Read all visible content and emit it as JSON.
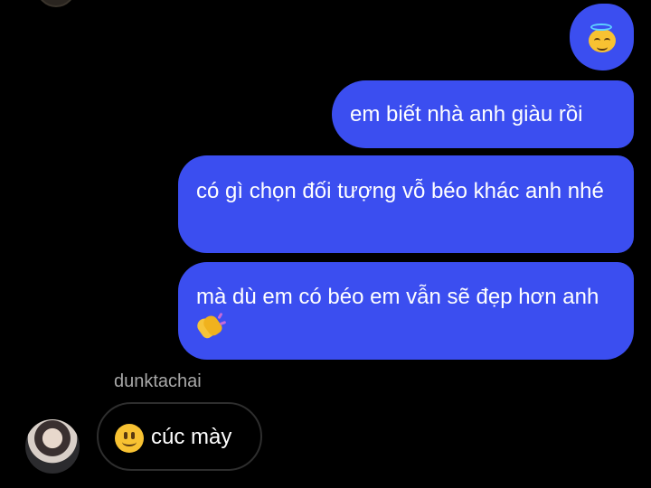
{
  "colors": {
    "background": "#000000",
    "outgoing_bubble": "#3b4ef0",
    "incoming_border": "#2e2e2e",
    "sender_name": "#a8a8a8"
  },
  "messages": {
    "outgoing": [
      {
        "emoji": "smiling-face-with-halo"
      },
      {
        "text": "em biết nhà anh giàu rồi"
      },
      {
        "text": "có gì chọn đối tượng vỗ béo khác anh nhé"
      },
      {
        "text": "mà dù em có béo em vẫn sẽ đẹp hơn anh",
        "trailing_emoji": "clapping-hands"
      }
    ],
    "incoming": {
      "sender": "dunktachai",
      "emoji": "slightly-smiling-face",
      "text": "cúc mày"
    }
  }
}
